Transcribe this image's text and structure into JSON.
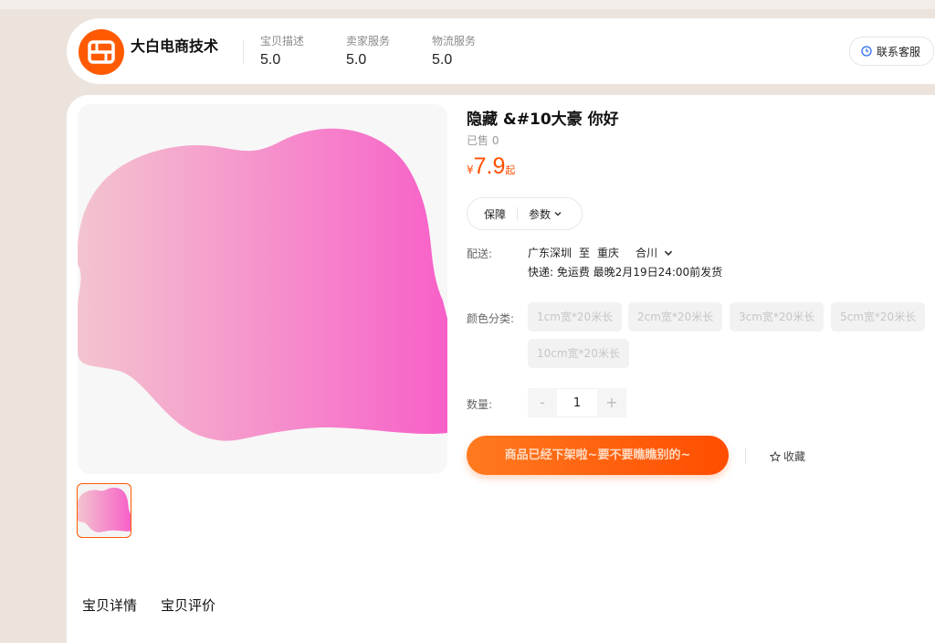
{
  "shop": {
    "name": "大白电商技术",
    "ratings": [
      {
        "label": "宝贝描述",
        "value": "5.0"
      },
      {
        "label": "卖家服务",
        "value": "5.0"
      },
      {
        "label": "物流服务",
        "value": "5.0"
      }
    ],
    "contact_label": "联系客服"
  },
  "product": {
    "title": "隐藏 &#10大豪 你好",
    "sold": "已售 0",
    "price": {
      "currency": "¥",
      "amount": "7.9",
      "suffix": "起"
    },
    "info_tabs": {
      "guarantee": "保障",
      "params": "参数"
    },
    "shipping": {
      "label": "配送:",
      "from": "广东深圳",
      "to_word": "至",
      "city": "重庆",
      "district": "合川",
      "detail": "快递: 免运费  最晚2月19日24:00前发货"
    },
    "color": {
      "label": "颜色分类:",
      "options": [
        "1cm宽*20米长",
        "2cm宽*20米长",
        "3cm宽*20米长",
        "5cm宽*20米长",
        "10cm宽*20米长"
      ]
    },
    "quantity": {
      "label": "数量:",
      "minus": "-",
      "value": "1",
      "plus": "+"
    },
    "buy_label": "商品已经下架啦~要不要瞧瞧别的~",
    "favorite_label": "收藏"
  },
  "detail_tabs": [
    "宝贝详情",
    "宝贝评价"
  ],
  "colors": {
    "accent": "#ff5000",
    "blob_start": "#f3c4cf",
    "blob_end": "#f760c8"
  },
  "icons": [
    "clock-icon",
    "chevron-down-icon",
    "star-outline-icon"
  ]
}
